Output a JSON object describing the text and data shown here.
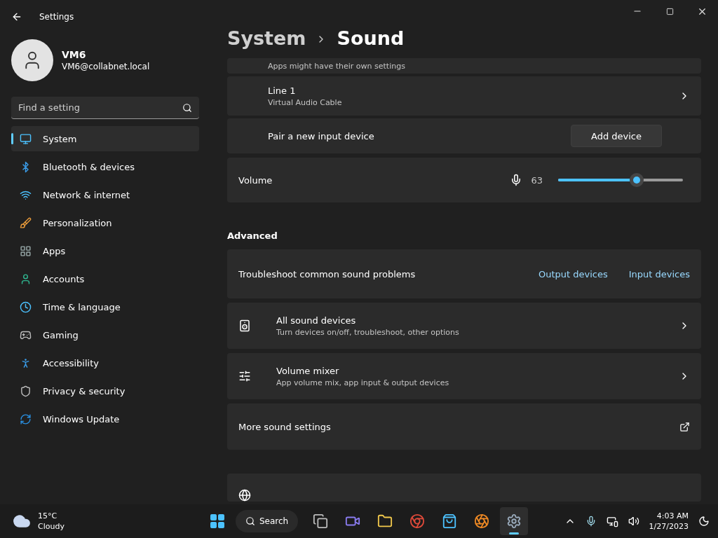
{
  "window": {
    "title": "Settings"
  },
  "user": {
    "name": "VM6",
    "email": "VM6@collabnet.local"
  },
  "search": {
    "placeholder": "Find a setting"
  },
  "nav": [
    {
      "label": "System",
      "selected": true
    },
    {
      "label": "Bluetooth & devices",
      "selected": false
    },
    {
      "label": "Network & internet",
      "selected": false
    },
    {
      "label": "Personalization",
      "selected": false
    },
    {
      "label": "Apps",
      "selected": false
    },
    {
      "label": "Accounts",
      "selected": false
    },
    {
      "label": "Time & language",
      "selected": false
    },
    {
      "label": "Gaming",
      "selected": false
    },
    {
      "label": "Accessibility",
      "selected": false
    },
    {
      "label": "Privacy & security",
      "selected": false
    },
    {
      "label": "Windows Update",
      "selected": false
    }
  ],
  "breadcrumb": [
    "System",
    "Sound"
  ],
  "input_devices": [
    {
      "kind": "note",
      "subtitle": "Apps might have their own settings"
    },
    {
      "kind": "device",
      "title": "Line 1",
      "subtitle": "Virtual Audio Cable"
    },
    {
      "kind": "pair",
      "title": "Pair a new input device",
      "button": "Add device"
    }
  ],
  "volume": {
    "label": "Volume",
    "reading": "63",
    "level": 0.63
  },
  "advanced": {
    "heading": "Advanced",
    "items": [
      {
        "kind": "links",
        "title": "Troubleshoot common sound problems",
        "links": [
          "Output devices",
          "Input devices"
        ]
      },
      {
        "kind": "nav",
        "title": "All sound devices",
        "subtitle": "Turn devices on/off, troubleshoot, other options"
      },
      {
        "kind": "nav",
        "title": "Volume mixer",
        "subtitle": "App volume mix, app input & output devices"
      },
      {
        "kind": "external",
        "title": "More sound settings"
      },
      {
        "kind": "partial"
      }
    ]
  },
  "taskbar": {
    "weather": {
      "temp": "15°C",
      "condition": "Cloudy"
    },
    "search": "Search",
    "apps": [
      {
        "selected": false
      },
      {
        "selected": false
      },
      {
        "selected": false
      },
      {
        "selected": false
      },
      {
        "selected": false
      },
      {
        "selected": false
      },
      {
        "selected": true
      }
    ],
    "time": "4:03 AM",
    "date": "1/27/2023"
  }
}
